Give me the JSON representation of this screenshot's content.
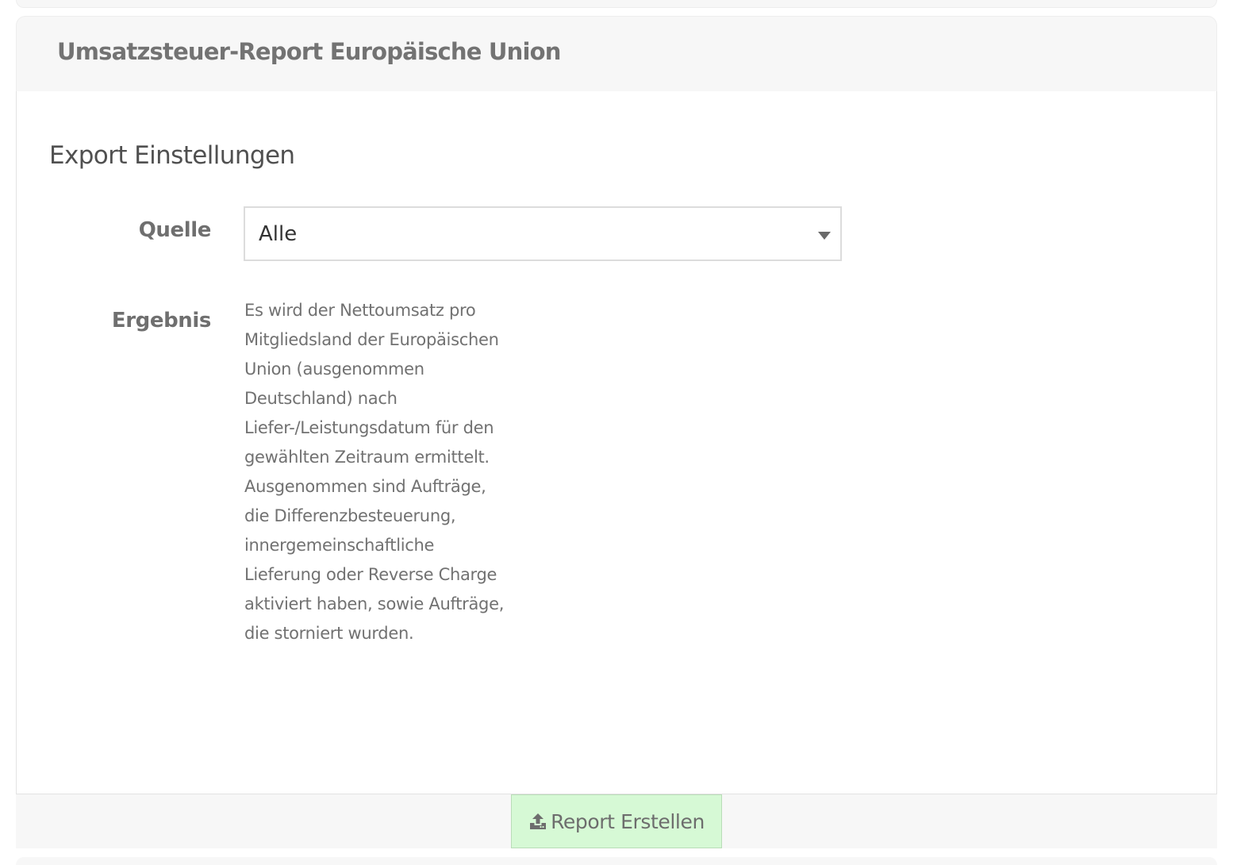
{
  "panel": {
    "title": "Umsatzsteuer-Report Europäische Union"
  },
  "export_settings": {
    "heading": "Export Einstellungen",
    "source": {
      "label": "Quelle",
      "selected": "Alle"
    },
    "result": {
      "label": "Ergebnis",
      "text": "Es wird der Nettoumsatz pro Mitgliedsland der Europäischen Union (ausgenommen Deutschland) nach Liefer-/Leistungsdatum für den gewählten Zeitraum ermittelt. Ausgenommen sind Aufträge, die Differenzbesteuerung, innergemeinschaftliche Lieferung oder Reverse Charge aktiviert haben, sowie Aufträge, die storniert wurden."
    }
  },
  "footer": {
    "button_label": "Report Erstellen",
    "button_icon": "upload-icon",
    "button_color": "#d6f9d5"
  }
}
